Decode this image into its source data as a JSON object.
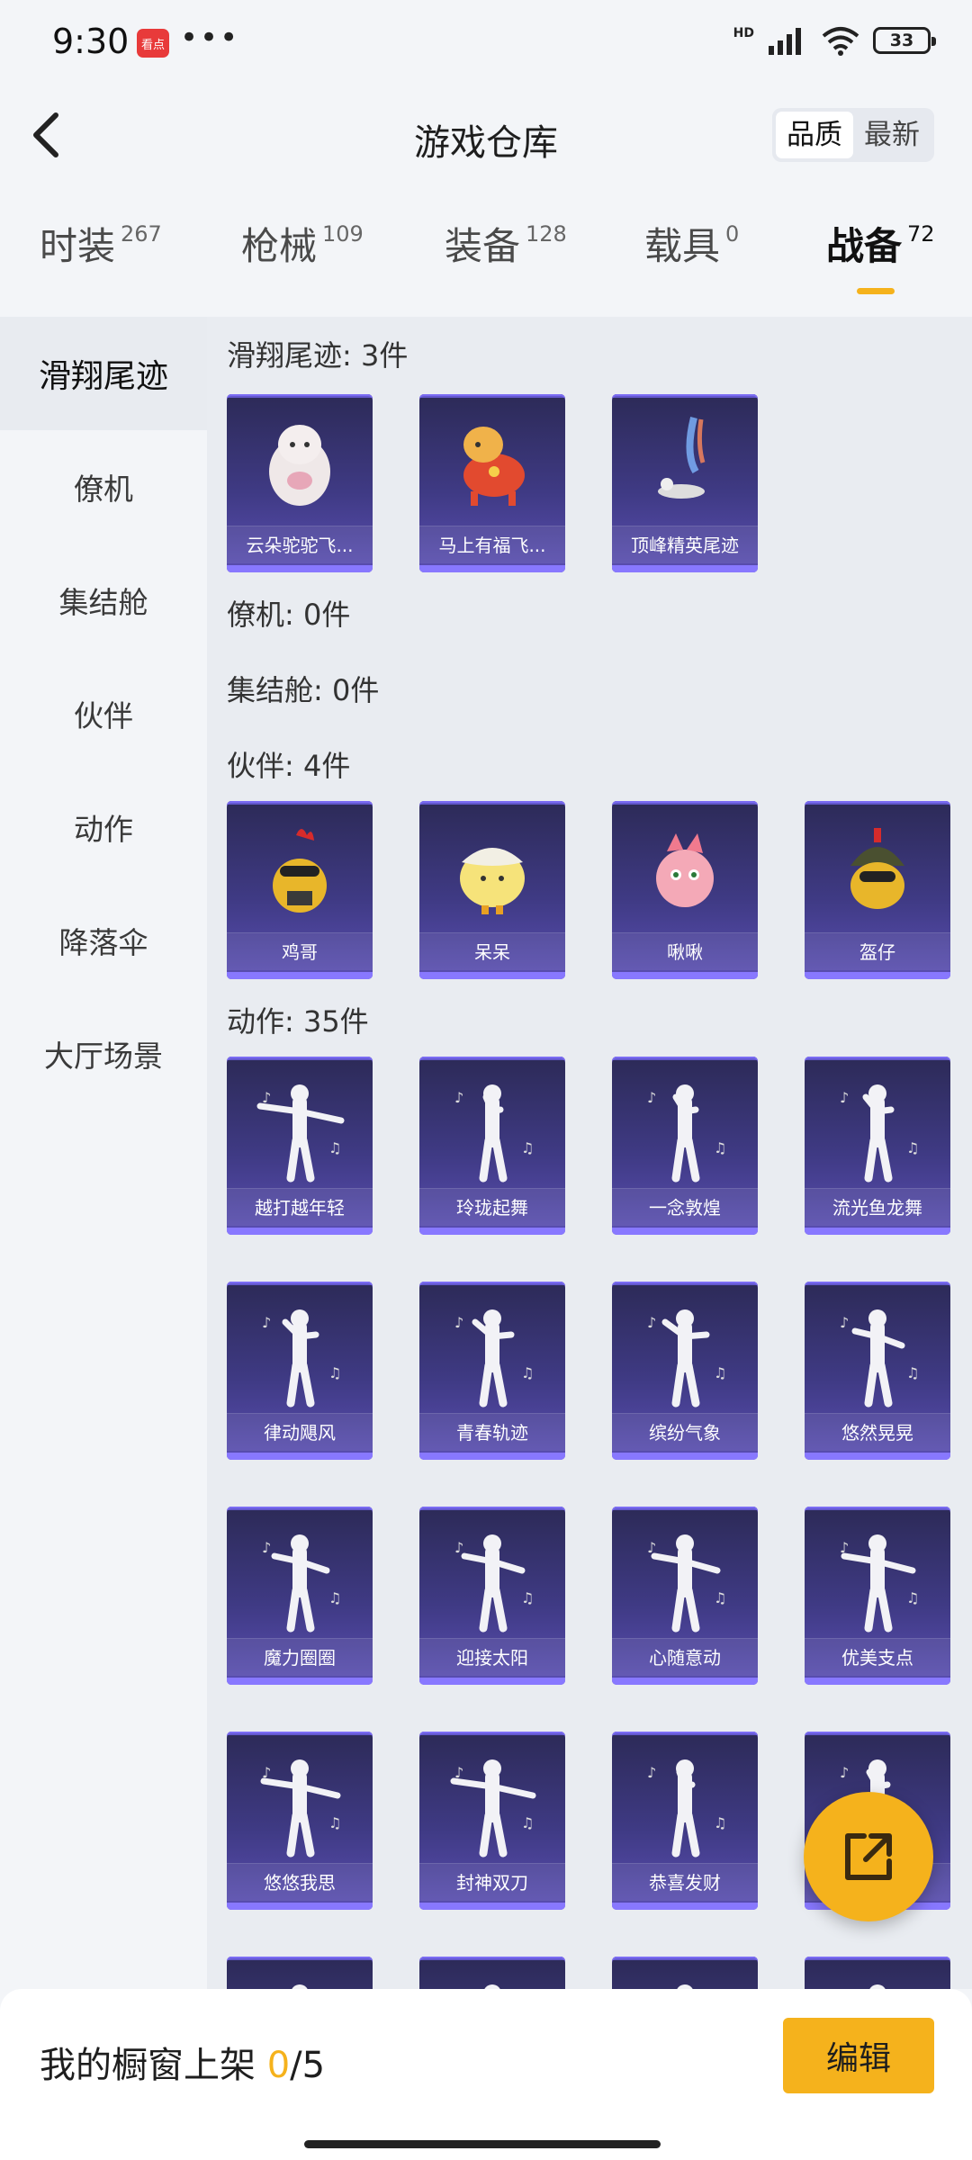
{
  "status": {
    "time": "9:30",
    "app_badge": "看点",
    "dots": "•••",
    "hd": "HD",
    "battery": "33"
  },
  "header": {
    "title": "游戏仓库",
    "sort_options": [
      "品质",
      "最新"
    ],
    "sort_selected": "品质"
  },
  "tabs": [
    {
      "label": "时装",
      "count": "267"
    },
    {
      "label": "枪械",
      "count": "109"
    },
    {
      "label": "装备",
      "count": "128"
    },
    {
      "label": "载具",
      "count": "0"
    },
    {
      "label": "战备",
      "count": "72"
    }
  ],
  "active_tab": "战备",
  "sidebar": {
    "items": [
      "滑翔尾迹",
      "僚机",
      "集结舱",
      "伙伴",
      "动作",
      "降落伞",
      "大厅场景"
    ],
    "active": "滑翔尾迹"
  },
  "sections": {
    "glide": {
      "title": "滑翔尾迹: 3件",
      "items": [
        "云朵驼驼飞...",
        "马上有福飞...",
        "顶峰精英尾迹"
      ]
    },
    "wingman": {
      "title": "僚机: 0件"
    },
    "pod": {
      "title": "集结舱: 0件"
    },
    "partner": {
      "title": "伙伴: 4件",
      "items": [
        "鸡哥",
        "呆呆",
        "啾啾",
        "盔仔"
      ]
    },
    "emote": {
      "title": "动作: 35件",
      "items": [
        "越打越年轻",
        "玲珑起舞",
        "一念敦煌",
        "流光鱼龙舞",
        "律动飓风",
        "青春轨迹",
        "缤纷气象",
        "悠然晃晃",
        "魔力圈圈",
        "迎接太阳",
        "心随意动",
        "优美支点",
        "悠悠我思",
        "封神双刀",
        "恭喜发财",
        ""
      ]
    }
  },
  "bottom_bar": {
    "label": "我的橱窗上架",
    "current": "0",
    "total": "/5",
    "edit_label": "编辑"
  },
  "colors": {
    "accent": "#f5b21c",
    "card_top": "#2c2a57",
    "card_bottom": "#5a4eb2"
  }
}
